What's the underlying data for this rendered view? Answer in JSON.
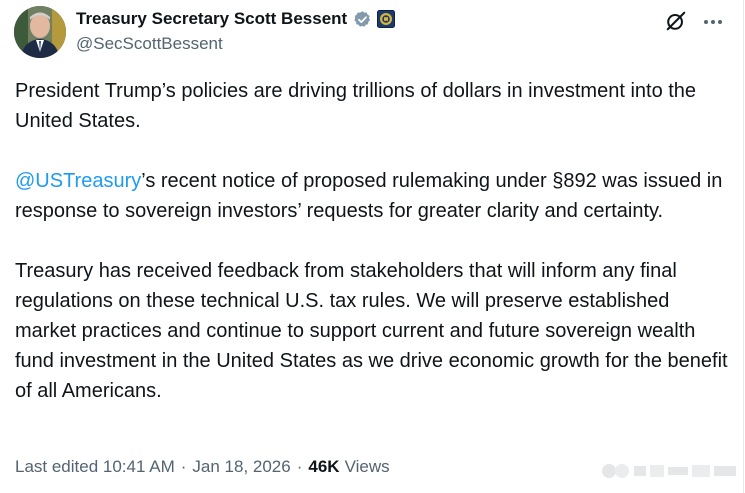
{
  "author": {
    "display_name": "Treasury Secretary Scott Bessent",
    "handle": "@SecScottBessent",
    "verified_badge": "gray-check-badge-icon",
    "affiliation_badge": "treasury-seal-icon"
  },
  "post": {
    "paragraph1": "President Trump’s policies are driving trillions of dollars in investment into the United States.",
    "paragraph2_mention": "@USTreasury",
    "paragraph2_rest": "’s recent notice of proposed rulemaking under §892 was issued in response to sovereign investors’ requests for greater clarity and certainty.",
    "paragraph3": "Treasury has received feedback from stakeholders that will inform any final regulations on these technical U.S. tax rules. We will preserve established market practices and continue to support current and future sovereign wealth fund investment in the United States as we drive economic growth for the benefit of all Americans."
  },
  "meta": {
    "edited": "Last edited 10:41 AM",
    "separator": "·",
    "date": "Jan 18, 2026",
    "views_count": "46K",
    "views_label": "Views"
  },
  "colors": {
    "text": "#0f1419",
    "secondary": "#536471",
    "link": "#1d9bf0"
  }
}
